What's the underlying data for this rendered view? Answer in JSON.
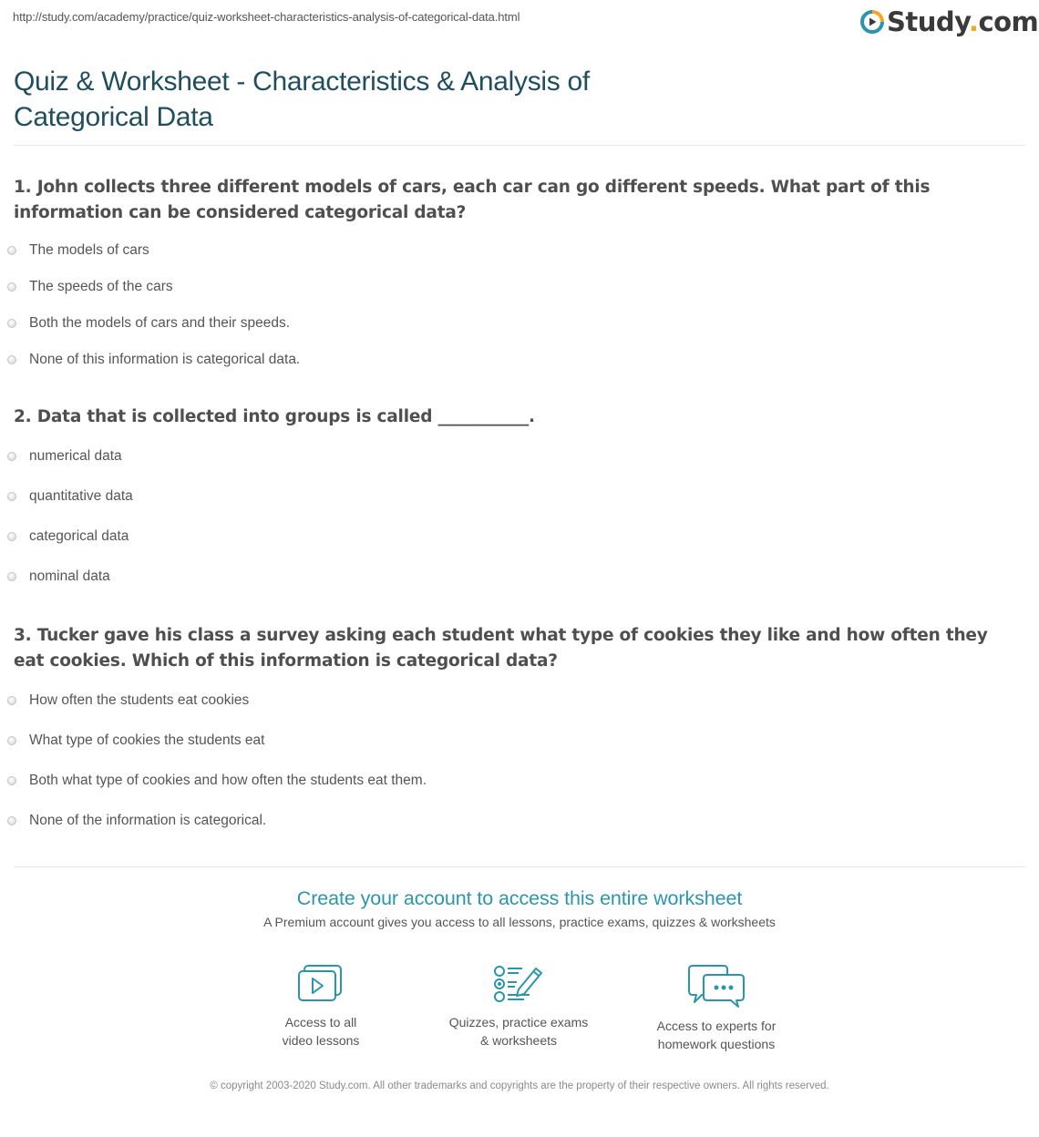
{
  "browser": {
    "url": "http://study.com/academy/practice/quiz-worksheet-characteristics-analysis-of-categorical-data.html"
  },
  "brand": {
    "name_main": "Study",
    "name_dot": ".",
    "name_tld": "com",
    "logo_icon": "play-circle-icon",
    "colors": {
      "blue": "#2a96ad",
      "orange": "#f5a623",
      "title": "#1f4e5f"
    }
  },
  "page": {
    "title": "Quiz & Worksheet - Characteristics & Analysis of Categorical Data"
  },
  "questions": [
    {
      "text": "1. John collects three different models of cars, each car can go different speeds. What part of this information can be considered categorical data?",
      "answers": [
        "The models of cars",
        "The speeds of the cars",
        "Both the models of cars and their speeds.",
        "None of this information is categorical data."
      ]
    },
    {
      "text": "2. Data that is collected into groups is called ___________.",
      "answers": [
        "numerical data",
        "quantitative data",
        "categorical data",
        "nominal data"
      ]
    },
    {
      "text": "3. Tucker gave his class a survey asking each student what type of cookies they like and how often they eat cookies. Which of this information is categorical data?",
      "answers": [
        "How often the students eat cookies",
        "What type of cookies the students eat",
        "Both what type of cookies and how often the students eat them.",
        "None of the information is categorical."
      ]
    }
  ],
  "cta": {
    "title": "Create your account to access this entire worksheet",
    "subtitle": "A Premium account gives you access to all lessons, practice exams, quizzes & worksheets",
    "features": [
      {
        "icon": "video-lessons-icon",
        "line1": "Access to all",
        "line2": "video lessons"
      },
      {
        "icon": "quiz-checklist-icon",
        "line1": "Quizzes, practice exams",
        "line2": "& worksheets"
      },
      {
        "icon": "chat-bubbles-icon",
        "line1": "Access to experts for",
        "line2": "homework questions"
      }
    ]
  },
  "footer": {
    "copyright": "© copyright 2003-2020 Study.com. All other trademarks and copyrights are the property of their respective owners. All rights reserved."
  }
}
